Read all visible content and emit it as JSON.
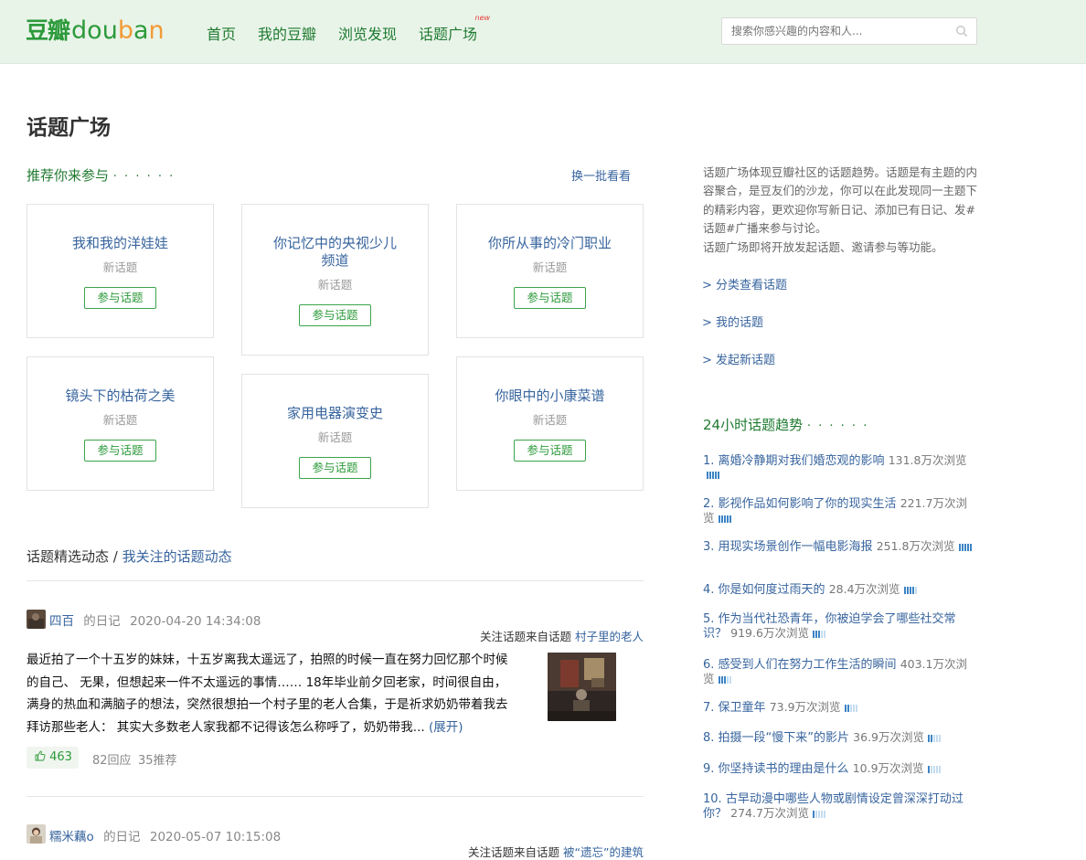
{
  "header": {
    "logo_cn": "豆瓣",
    "logo_en": "douban",
    "nav": [
      {
        "label": "首页"
      },
      {
        "label": "我的豆瓣"
      },
      {
        "label": "浏览发现"
      },
      {
        "label": "话题广场",
        "badge": "new"
      }
    ],
    "search_placeholder": "搜索你感兴趣的内容和人..."
  },
  "page_title": "话题广场",
  "recommend": {
    "heading": "推荐你来参与",
    "dots": "· · · · · ·",
    "refresh_label": "换一批看看",
    "cards": [
      {
        "title": "我和我的洋娃娃",
        "sub": "新话题",
        "button": "参与话题"
      },
      {
        "title": "你记忆中的央视少儿频道",
        "sub": "新话题",
        "button": "参与话题"
      },
      {
        "title": "你所从事的冷门职业",
        "sub": "新话题",
        "button": "参与话题"
      },
      {
        "title": "镜头下的枯荷之美",
        "sub": "新话题",
        "button": "参与话题"
      },
      {
        "title": "家用电器演变史",
        "sub": "新话题",
        "button": "参与话题"
      },
      {
        "title": "你眼中的小康菜谱",
        "sub": "新话题",
        "button": "参与话题"
      }
    ]
  },
  "feed": {
    "heading": "话题精选动态",
    "separator": " / ",
    "heading_link": "我关注的话题动态",
    "posts": [
      {
        "author": "四百",
        "type": "的日记",
        "time": "2020-04-20 14:34:08",
        "topic_prefix": "关注话题来自话题",
        "topic": "村子里的老人",
        "body": "最近拍了一个十五岁的妹妹，十五岁离我太遥远了，拍照的时候一直在努力回忆那个时候的自己、 无果，但想起来一件不太遥远的事情…… 18年毕业前夕回老家，时间很自由，满身的热血和满脑子的想法，突然很想拍一个村子里的老人合集，于是祈求奶奶带着我去拜访那些老人： 其实大多数老人家我都不记得该怎么称呼了，奶奶带我...",
        "expand": "(展开)",
        "likes": "463",
        "replies": "82回应",
        "recommends": "35推荐"
      },
      {
        "author": "糯米藕o",
        "type": "的日记",
        "time": "2020-05-07 10:15:08",
        "topic_prefix": "关注话题来自话题",
        "topic": "被“遗忘”的建筑"
      }
    ]
  },
  "sidebar": {
    "intro": "话题广场体现豆瓣社区的话题趋势。话题是有主题的内容聚合，是豆友们的沙龙，你可以在此发现同一主题下的精彩内容，更欢迎你写新日记、添加已有日记、发#话题#广播来参与讨论。",
    "intro2": "话题广场即将开放发起话题、邀请参与等功能。",
    "links": [
      "> 分类查看话题",
      "> 我的话题",
      "> 发起新话题"
    ],
    "trend_heading": "24小时话题趋势",
    "trend_dots": "· · · · · ·",
    "trends": [
      {
        "rank": "1.",
        "title": "离婚冷静期对我们婚恋观的影响",
        "views": "131.8万次浏览",
        "level": 5
      },
      {
        "rank": "2.",
        "title": "影视作品如何影响了你的现实生活",
        "views": "221.7万次浏览",
        "level": 5
      },
      {
        "rank": "3.",
        "title": "用现实场景创作一幅电影海报",
        "views": "251.8万次浏览",
        "level": 5
      },
      {
        "rank": "4.",
        "title": "你是如何度过雨天的",
        "views": "28.4万次浏览",
        "level": 4
      },
      {
        "rank": "5.",
        "title": "作为当代社恐青年，你被迫学会了哪些社交常识？",
        "views": "919.6万次浏览",
        "level": 3
      },
      {
        "rank": "6.",
        "title": "感受到人们在努力工作生活的瞬间",
        "views": "403.1万次浏览",
        "level": 3
      },
      {
        "rank": "7.",
        "title": "保卫童年",
        "views": "73.9万次浏览",
        "level": 2
      },
      {
        "rank": "8.",
        "title": "拍摄一段“慢下来”的影片",
        "views": "36.9万次浏览",
        "level": 2
      },
      {
        "rank": "9.",
        "title": "你坚持读书的理由是什么",
        "views": "10.9万次浏览",
        "level": 1
      },
      {
        "rank": "10.",
        "title": "古早动漫中哪些人物或剧情设定曾深深打动过你？",
        "views": "274.7万次浏览",
        "level": 1
      }
    ]
  },
  "colors": {
    "brand_green": "#2d9a3b",
    "header_bg": "#e9f4e9",
    "link_blue": "#37649e",
    "bar_on": "#3b83c5",
    "bar_off": "#c5dcf0"
  }
}
